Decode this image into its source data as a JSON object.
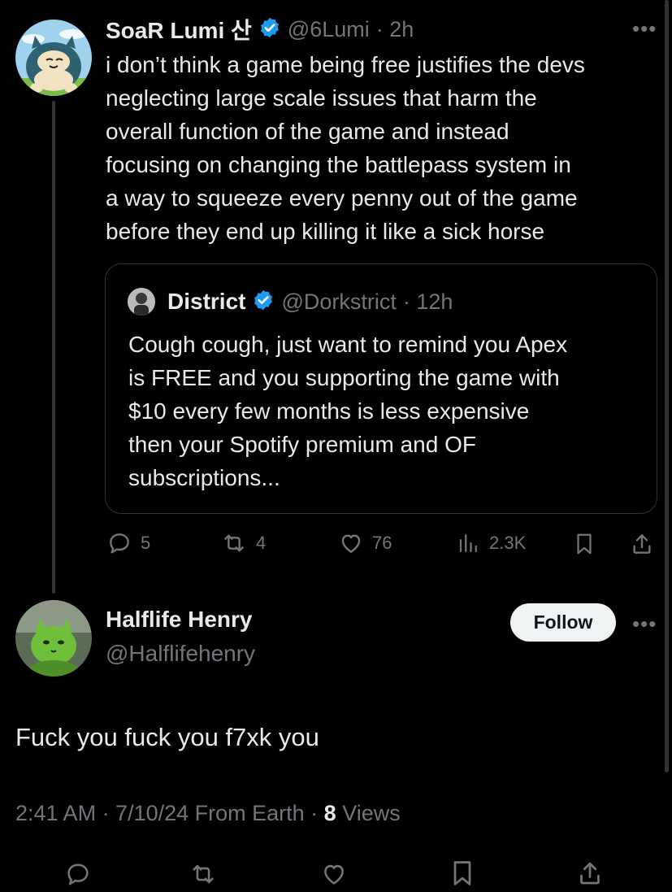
{
  "tweet": {
    "display_name": "SoaR Lumi 산",
    "handle": "@6Lumi",
    "time": "· 2h",
    "lines": [
      "i don’t think a game being free justifies the devs",
      "neglecting large scale issues that harm the",
      "overall function of the game and instead",
      "focusing on changing the battlepass system in",
      "a way to squeeze every penny out of the game",
      "before they end up killing it like a sick horse"
    ],
    "quote": {
      "display_name": "District",
      "handle": "@Dorkstrict",
      "time": "· 12h",
      "lines": [
        "Cough cough, just want to remind you Apex",
        "is FREE and you supporting the game with",
        "$10 every few months is less expensive",
        "then your Spotify premium and OF",
        "subscriptions..."
      ]
    },
    "stats": {
      "replies": "5",
      "reposts": "4",
      "likes": "76",
      "views": "2.3K"
    },
    "more_icon": "more-dots-icon"
  },
  "reply": {
    "display_name": "Halflife Henry",
    "handle": "@Halflifehenry",
    "follow_label": "Follow",
    "text": "Fuck you fuck you f7xk you",
    "meta_time": "2:41 AM · 7/10/24 From Earth · ",
    "meta_views_count": "8",
    "meta_views_label": " Views"
  },
  "colors": {
    "background": "#000000",
    "text": "#e7e9ea",
    "muted": "#71767b",
    "verified": "#1d9bf0",
    "border": "#2f3336"
  }
}
